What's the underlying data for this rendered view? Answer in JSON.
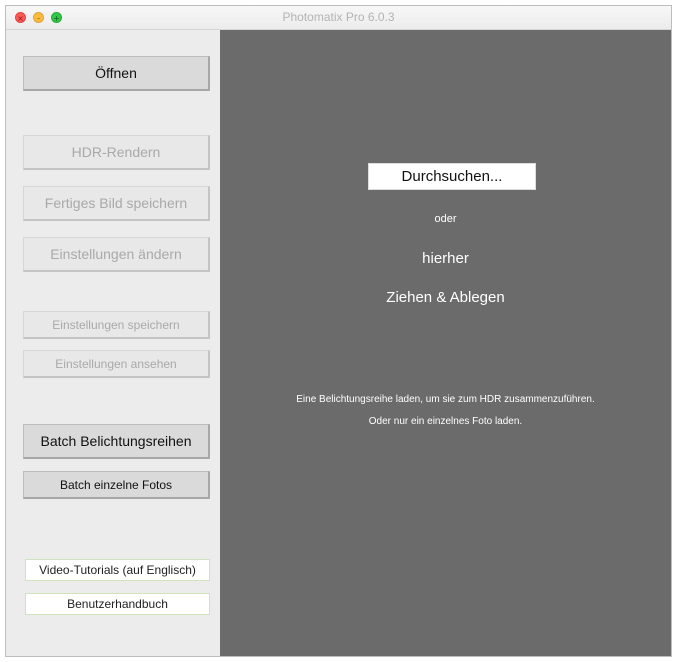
{
  "window": {
    "title": "Photomatix Pro 6.0.3"
  },
  "traffic_lights": {
    "close": "×",
    "minimize": "–",
    "maximize": "+"
  },
  "sidebar": {
    "open": "Öffnen",
    "hdr_render": "HDR-Rendern",
    "save_final": "Fertiges Bild speichern",
    "change_settings": "Einstellungen ändern",
    "save_settings": "Einstellungen speichern",
    "view_settings": "Einstellungen ansehen",
    "batch_brackets": "Batch Belichtungsreihen",
    "batch_single": "Batch einzelne Fotos",
    "video_tutorials": "Video-Tutorials (auf Englisch)",
    "manual": "Benutzerhandbuch"
  },
  "main": {
    "browse": "Durchsuchen...",
    "or": "oder",
    "here": "hierher",
    "drag_drop": "Ziehen & Ablegen",
    "hint_line1": "Eine Belichtungsreihe laden, um sie zum HDR zusammenzuführen.",
    "hint_line2": "Oder nur ein einzelnes Foto laden."
  },
  "colors": {
    "main_background": "#6b6b6b",
    "sidebar_background": "#ececec",
    "close": "#fc5b57",
    "minimize": "#fdbc40",
    "maximize": "#33c748"
  }
}
